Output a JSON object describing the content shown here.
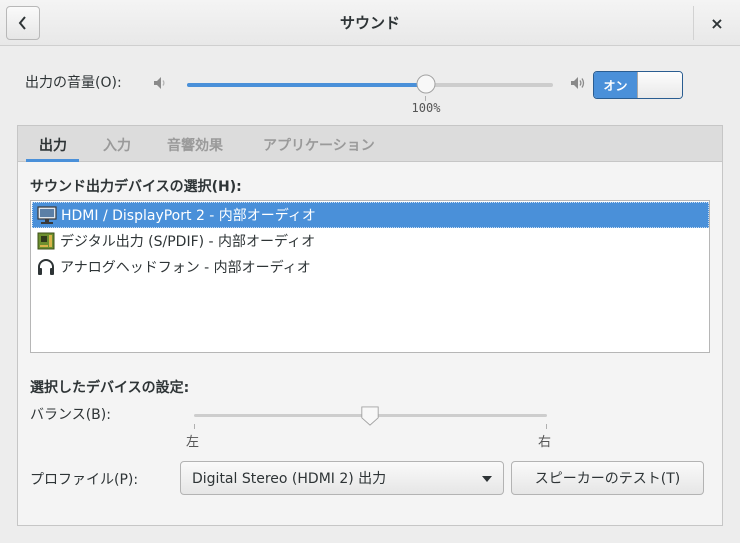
{
  "window": {
    "title": "サウンド",
    "back_icon": "chevron-left-icon",
    "close_label": "×"
  },
  "volume": {
    "label": "出力の音量(O):",
    "value_percent": 100,
    "value_label": "100%",
    "low_icon": "speaker-low-icon",
    "high_icon": "speaker-high-icon",
    "switch_label": "オン",
    "switch_state": "on",
    "accent_color": "#4a90d9"
  },
  "tabs": [
    {
      "label": "出力",
      "active": true
    },
    {
      "label": "入力",
      "active": false
    },
    {
      "label": "音響効果",
      "active": false
    },
    {
      "label": "アプリケーション",
      "active": false
    }
  ],
  "output": {
    "device_heading": "サウンド出力デバイスの選択(H):",
    "devices": [
      {
        "label": "HDMI / DisplayPort 2 - 内部オーディオ",
        "icon": "monitor-icon",
        "selected": true
      },
      {
        "label": "デジタル出力 (S/PDIF) - 内部オーディオ",
        "icon": "sound-card-icon",
        "selected": false
      },
      {
        "label": "アナログヘッドフォン - 内部オーディオ",
        "icon": "headphones-icon",
        "selected": false
      }
    ],
    "settings_heading": "選択したデバイスの設定:",
    "balance": {
      "label": "バランス(B):",
      "left_mark": "左",
      "right_mark": "右",
      "value": 0.5
    },
    "profile": {
      "label": "プロファイル(P):",
      "selected": "Digital Stereo (HDMI 2) 出力"
    },
    "test_button_label": "スピーカーのテスト(T)"
  }
}
